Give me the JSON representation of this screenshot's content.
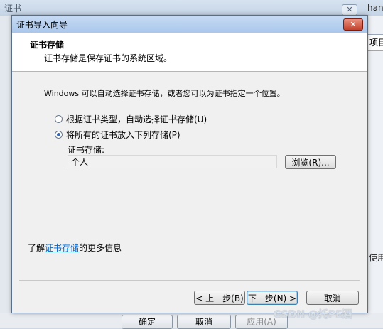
{
  "background_window": {
    "title": "证书",
    "right_texts": [
      "hang",
      "项目",
      "使用"
    ],
    "buttons": {
      "ok": "确定",
      "cancel": "取消",
      "apply": "应用(A)"
    }
  },
  "dialog": {
    "title": "证书导入向导",
    "header": {
      "title": "证书存储",
      "description": "证书存储是保存证书的系统区域。"
    },
    "intro": "Windows 可以自动选择证书存储，或者您可以为证书指定一个位置。",
    "options": [
      {
        "label": "根据证书类型，自动选择证书存储(U)",
        "checked": false
      },
      {
        "label": "将所有的证书放入下列存储(P)",
        "checked": true
      }
    ],
    "store": {
      "label": "证书存储:",
      "value": "个人",
      "browse": "浏览(R)..."
    },
    "learn_more": {
      "prefix": "了解",
      "link": "证书存储",
      "suffix": "的更多信息"
    },
    "buttons": {
      "back": "< 上一步(B)",
      "next": "下一步(N) >",
      "cancel": "取消"
    }
  },
  "watermark": "CSDN @托PE酒"
}
